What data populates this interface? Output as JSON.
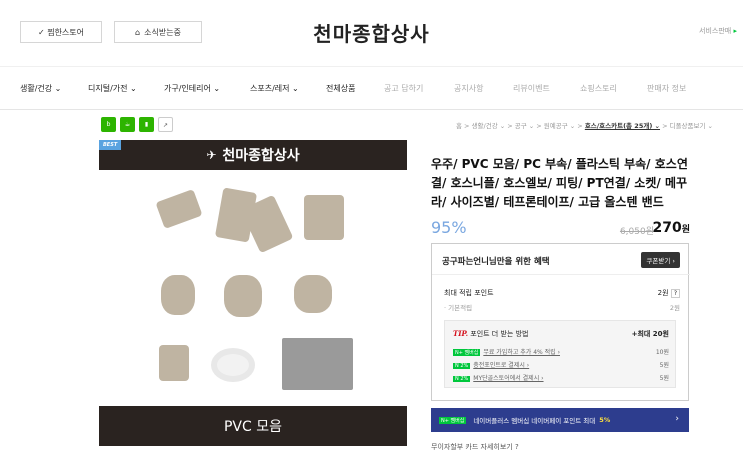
{
  "header": {
    "favorite_label": "✓ 찜한스토어",
    "notice_label": "소식받는중",
    "store_name": "천마종합상사",
    "service_label": "서비스판매"
  },
  "nav": {
    "items": [
      {
        "label": "생활/건강 ⌄",
        "dim": false
      },
      {
        "label": "디지털/가전 ⌄",
        "dim": false
      },
      {
        "label": "가구/인테리어 ⌄",
        "dim": false
      },
      {
        "label": "스포츠/레저 ⌄",
        "dim": false
      },
      {
        "label": "전체상품",
        "dim": false
      },
      {
        "label": "공고 답하기",
        "dim": true
      },
      {
        "label": "공지사항",
        "dim": true
      },
      {
        "label": "리뷰이벤트",
        "dim": true
      },
      {
        "label": "쇼핑스토리",
        "dim": true
      },
      {
        "label": "판매자 정보",
        "dim": true
      }
    ]
  },
  "share": {
    "icons": [
      "blog",
      "talk",
      "bookmark",
      "share"
    ]
  },
  "breadcrumb": {
    "text": "홈 > 생활/건강 ⌄ > 공구 ⌄ > 원예공구 ⌄ > ",
    "current": "호스/호스카트(총 25개) ⌄",
    "tail": " > 디폴상품보기 ⌄"
  },
  "image": {
    "badge": "BEST",
    "brand": "천마종합상사",
    "footer": "PVC 모음"
  },
  "product": {
    "title": "우주/ PVC 모음/ PC 부속/ 플라스틱 부속/ 호스연결/ 호스니플/ 호스엘보/ 피팅/ PT연결/ 소켓/ 메꾸라/ 사이즈별/ 테프론테이프/ 고급 올스텐 밴드",
    "discount": "95%",
    "original_price": "6,050원",
    "price": "270",
    "price_unit": "원"
  },
  "benefit": {
    "heading": "공구파는언니님만을 위한 혜택",
    "coupon_label": "쿠폰받기 ›",
    "max_point_label": "최대 적립 포인트",
    "max_point_value": "2원",
    "base_label": "· 기본적립",
    "base_value": "2원",
    "tip_prefix": "TIP.",
    "tip_text": " 포인트 더 받는 방법",
    "tip_total": "+최대 20원",
    "tip_rows": [
      {
        "badge": "N+ 멤버십",
        "label": "무료 가입하고 추가 4% 적립 ›",
        "value": "10원"
      },
      {
        "badge": "N 2%",
        "label": "충전포인트로 결제시 ›",
        "value": "5원"
      },
      {
        "badge": "N 2%",
        "label": "MY단골스토어에서 결제시 ›",
        "value": "5원"
      }
    ]
  },
  "banner": {
    "badge": "N+ 멤버십",
    "text": "네이버플러스 멤버십 네이버페이 포인트 최대",
    "highlight": "5%"
  },
  "installment": {
    "label": "무이자할부  카드 자세히보기 ?"
  },
  "colors": {
    "naver_green": "#00c73c",
    "banner_blue": "#2d3d8e",
    "discount_blue": "#7aa7e0",
    "tip_red": "#d4101c"
  }
}
